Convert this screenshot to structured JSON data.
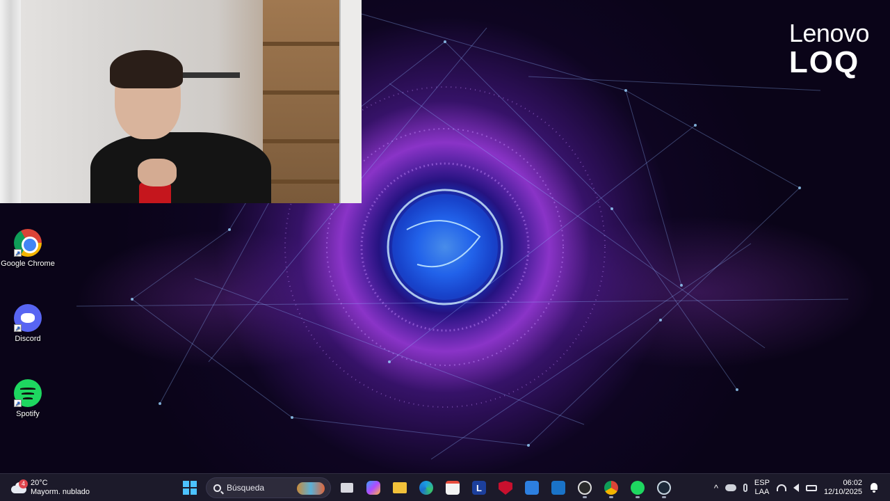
{
  "wallpaper": {
    "brand_line1": "Lenovo",
    "brand_line2": "LOQ",
    "accent_color": "#7b3cff"
  },
  "webcam": {
    "description_icon": "webcam-preview-icon"
  },
  "desktop_icons": [
    {
      "label": "Google Chrome",
      "icon": "chrome-icon"
    },
    {
      "label": "Discord",
      "icon": "discord-icon"
    },
    {
      "label": "Spotify",
      "icon": "spotify-icon"
    }
  ],
  "taskbar": {
    "weather": {
      "badge": "4",
      "temperature": "20°C",
      "condition": "Mayorm. nublado",
      "icon": "cloud-icon"
    },
    "search_placeholder": "Búsqueda",
    "app_letter_L": "L",
    "language_line1": "ESP",
    "language_line2": "LAA",
    "clock_time": "06:02",
    "clock_date": "12/10/2025",
    "tray_chevron": "^"
  }
}
